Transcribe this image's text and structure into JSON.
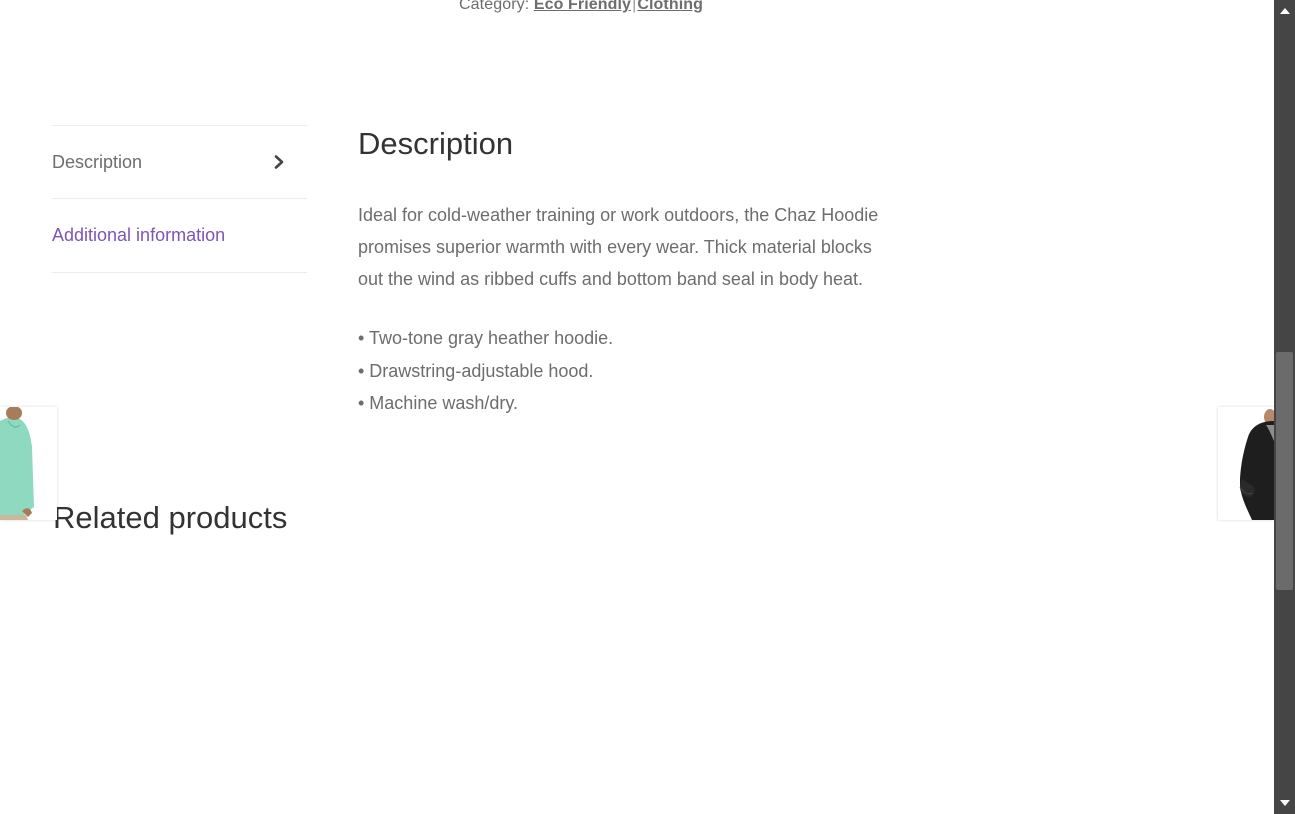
{
  "category": {
    "label": "Category:",
    "links": [
      "Eco Friendly",
      "Clothing"
    ],
    "separator": "|"
  },
  "tabs": [
    {
      "label": "Description",
      "active": true,
      "icon": "chevron-right-icon"
    },
    {
      "label": "Additional information",
      "active": false
    }
  ],
  "description": {
    "title": "Description",
    "paragraph_lines": [
      "Ideal for cold-weather training or work outdoors, the Chaz Hoodie",
      "promises superior warmth with every wear. Thick material blocks",
      "out the wind as ribbed cuffs and bottom band seal in body heat."
    ],
    "bullets": [
      "• Two-tone gray heather hoodie.",
      "• Drawstring-adjustable hood.",
      "• Machine wash/dry."
    ]
  },
  "related": {
    "title": "Related products"
  },
  "side_nav": {
    "prev_thumb": "mint-sweatshirt-image",
    "next_thumb": "black-hoodie-image"
  },
  "colors": {
    "link_purple": "#7f54b3",
    "text_gray": "#6d6d6d",
    "heading": "#333333",
    "scrollbar_track": "#454545"
  }
}
